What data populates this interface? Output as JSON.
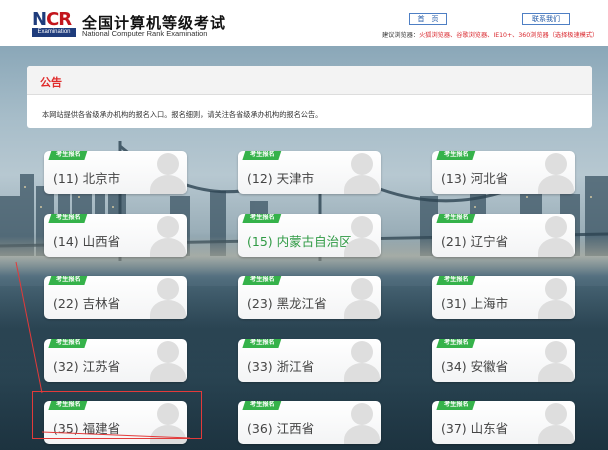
{
  "header": {
    "logo_text": "NCR",
    "logo_badge": "Examination",
    "site_title": "全国计算机等级考试",
    "site_subtitle": "National Computer Rank Examination",
    "nav": [
      {
        "label": "首　页"
      },
      {
        "label": "联系我们"
      }
    ],
    "browser_tip_prefix": "建议浏览器：",
    "browser_tip_list": "火狐浏览器、谷歌浏览器、IE10+、360浏览器（选择极速模式）"
  },
  "notice": {
    "title": "公告",
    "text": "本网站提供各省级承办机构的报名入口。报名细则，请关注各省级承办机构的报名公告。"
  },
  "badge_label": "考生报名",
  "provinces": [
    {
      "label": "(11) 北京市"
    },
    {
      "label": "(12) 天津市"
    },
    {
      "label": "(13) 河北省"
    },
    {
      "label": "(14) 山西省"
    },
    {
      "label": "(15) 内蒙古自治区"
    },
    {
      "label": "(21) 辽宁省"
    },
    {
      "label": "(22) 吉林省"
    },
    {
      "label": "(23) 黑龙江省"
    },
    {
      "label": "(31) 上海市"
    },
    {
      "label": "(32) 江苏省"
    },
    {
      "label": "(33) 浙江省"
    },
    {
      "label": "(34) 安徽省"
    },
    {
      "label": "(35) 福建省"
    },
    {
      "label": "(36) 江西省"
    },
    {
      "label": "(37) 山东省"
    }
  ],
  "colors": {
    "badge": "#35b24a",
    "notice_title": "#e02b2b",
    "highlight_text": "#2f9a44",
    "annotation": "#e23a3a",
    "brand": "#1f3c7c"
  }
}
